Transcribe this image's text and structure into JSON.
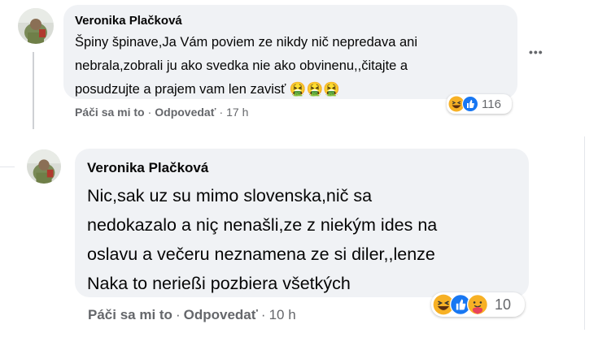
{
  "comments": [
    {
      "author": "Veronika Plačková",
      "lines": [
        "Špiny špinave,Ja Vám poviem ze nikdy nič nepredava ani",
        "nebrala,zobrali ju ako svedka nie ako obvinenu,,čitajte a",
        "posudzujte a prajem vam len zavisť 🤮🤮🤮"
      ],
      "like_label": "Páči sa mi to",
      "reply_label": "Odpovedať",
      "time": "17 h",
      "reaction_icons": [
        "haha-icon",
        "like-icon"
      ],
      "reaction_count": "116",
      "more_label": "•••"
    },
    {
      "author": "Veronika Plačková",
      "lines": [
        "Nic,sak uz su mimo slovenska,nič sa",
        "nedokazalo a niç nenašli,ze z niekým ides na",
        "oslavu a večeru neznamena ze si diler,,lenze",
        "Naka to nerießi pozbiera všetkých"
      ],
      "like_label": "Páči sa mi to",
      "reply_label": "Odpovedať",
      "time": "10 h",
      "reaction_icons": [
        "haha-icon",
        "like-icon",
        "care-icon"
      ],
      "reaction_count": "10"
    }
  ],
  "colors": {
    "bubble": "#f0f2f5",
    "meta": "#65676b",
    "like_blue": "#1877f2",
    "haha_yellow": "#f7b125"
  }
}
